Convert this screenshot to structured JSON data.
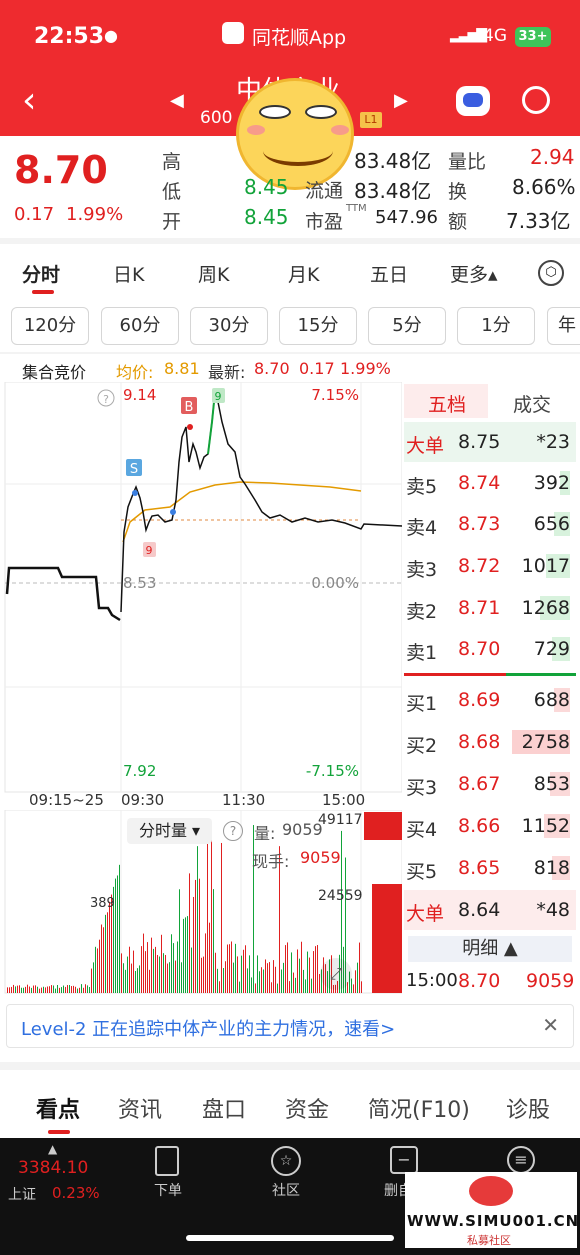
{
  "status": {
    "time": "22:53",
    "app": "同花顺App",
    "network": "4G",
    "battery": "33+"
  },
  "header": {
    "title_visible": "中体产业",
    "code": "600",
    "level_badge": "L1"
  },
  "quote": {
    "price": "8.70",
    "change": "0.17",
    "change_pct": "1.99%",
    "high_label": "高",
    "low_label": "低",
    "open_label": "开",
    "low_value": "8.45",
    "open_value": "8.45",
    "total_cap": "83.48亿",
    "float_label": "流通",
    "float_cap": "83.48亿",
    "pe_label": "市盈",
    "pe_sup": "TTM",
    "pe_value": "547.96",
    "vol_ratio_label": "量比",
    "vol_ratio": "2.94",
    "turnover_label": "换",
    "turnover": "8.66%",
    "amount_label": "额",
    "amount": "7.33亿"
  },
  "period_tabs": [
    "分时",
    "日K",
    "周K",
    "月K",
    "五日",
    "更多▴"
  ],
  "minute_tabs": [
    "120分",
    "60分",
    "30分",
    "15分",
    "5分",
    "1分",
    "年"
  ],
  "chart_info": {
    "auction": "集合竞价",
    "avg_label": "均价:",
    "avg": "8.81",
    "latest_label": "最新:",
    "latest": "8.70",
    "chg": "0.17",
    "pct": "1.99%"
  },
  "chart_data": {
    "type": "line",
    "y_top": "9.14",
    "y_mid": "8.53",
    "y_bottom": "7.92",
    "pct_top": "7.15%",
    "pct_mid": "0.00%",
    "pct_bottom": "-7.15%",
    "x_labels": [
      "09:15~25",
      "09:30",
      "11:30",
      "15:00"
    ],
    "marks": {
      "b": "B",
      "s": "S",
      "nine_a": "9",
      "nine_b": "9"
    }
  },
  "volume": {
    "selector": "分时量 ▾",
    "vol_label": "量:",
    "vol": "9059",
    "hand_label": "现手:",
    "hand": "9059",
    "max": "49117",
    "mid": "24559",
    "left": "389"
  },
  "orderbook": {
    "tab_five": "五档",
    "tab_deal": "成交",
    "big_sell": {
      "label": "大单",
      "price": "8.75",
      "vol": "*23"
    },
    "sells": [
      {
        "label": "卖5",
        "price": "8.74",
        "vol": "392"
      },
      {
        "label": "卖4",
        "price": "8.73",
        "vol": "656"
      },
      {
        "label": "卖3",
        "price": "8.72",
        "vol": "1017"
      },
      {
        "label": "卖2",
        "price": "8.71",
        "vol": "1268"
      },
      {
        "label": "卖1",
        "price": "8.70",
        "vol": "729"
      }
    ],
    "buys": [
      {
        "label": "买1",
        "price": "8.69",
        "vol": "688"
      },
      {
        "label": "买2",
        "price": "8.68",
        "vol": "2758"
      },
      {
        "label": "买3",
        "price": "8.67",
        "vol": "853"
      },
      {
        "label": "买4",
        "price": "8.66",
        "vol": "1152"
      },
      {
        "label": "买5",
        "price": "8.65",
        "vol": "818"
      }
    ],
    "big_buy": {
      "label": "大单",
      "price": "8.64",
      "vol": "*48"
    },
    "detail": "明细 ▲",
    "last_trade": {
      "time": "15:00",
      "price": "8.70",
      "vol": "9059"
    }
  },
  "banner": "Level-2 正在追踪中体产业的主力情况，速看>",
  "bottom_tabs": [
    "看点",
    "资讯",
    "盘口",
    "资金",
    "简况(F10)",
    "诊股"
  ],
  "navbar": {
    "index_value": "3384.10",
    "index_name": "上证",
    "index_pct": "0.23%",
    "order": "下单",
    "community": "社区",
    "delete_self": "删自"
  },
  "watermark": "WWW.SIMU001.CN",
  "watermark_sub": "私募社区",
  "colors": {
    "red": "#ee2b2f",
    "green": "#12a33a"
  }
}
